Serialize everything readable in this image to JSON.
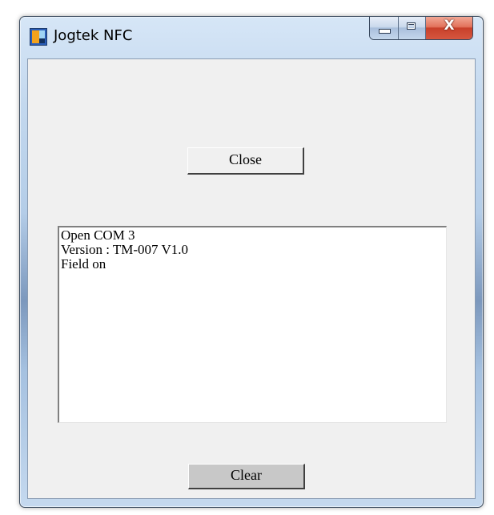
{
  "window": {
    "title": "Jogtek NFC",
    "icon": "jogtek-app-icon"
  },
  "caption_buttons": {
    "minimize_icon": "minimize-icon",
    "maximize_icon": "maximize-icon",
    "close_glyph": "X"
  },
  "main": {
    "close_button_label": "Close",
    "clear_button_label": "Clear",
    "log_lines": [
      "Open COM 3",
      "Version : TM-007 V1.0",
      "Field on"
    ]
  },
  "colors": {
    "frame_accent": "#b4cde8",
    "close_button_red": "#c8402a",
    "client_background": "#f0f0f0"
  }
}
